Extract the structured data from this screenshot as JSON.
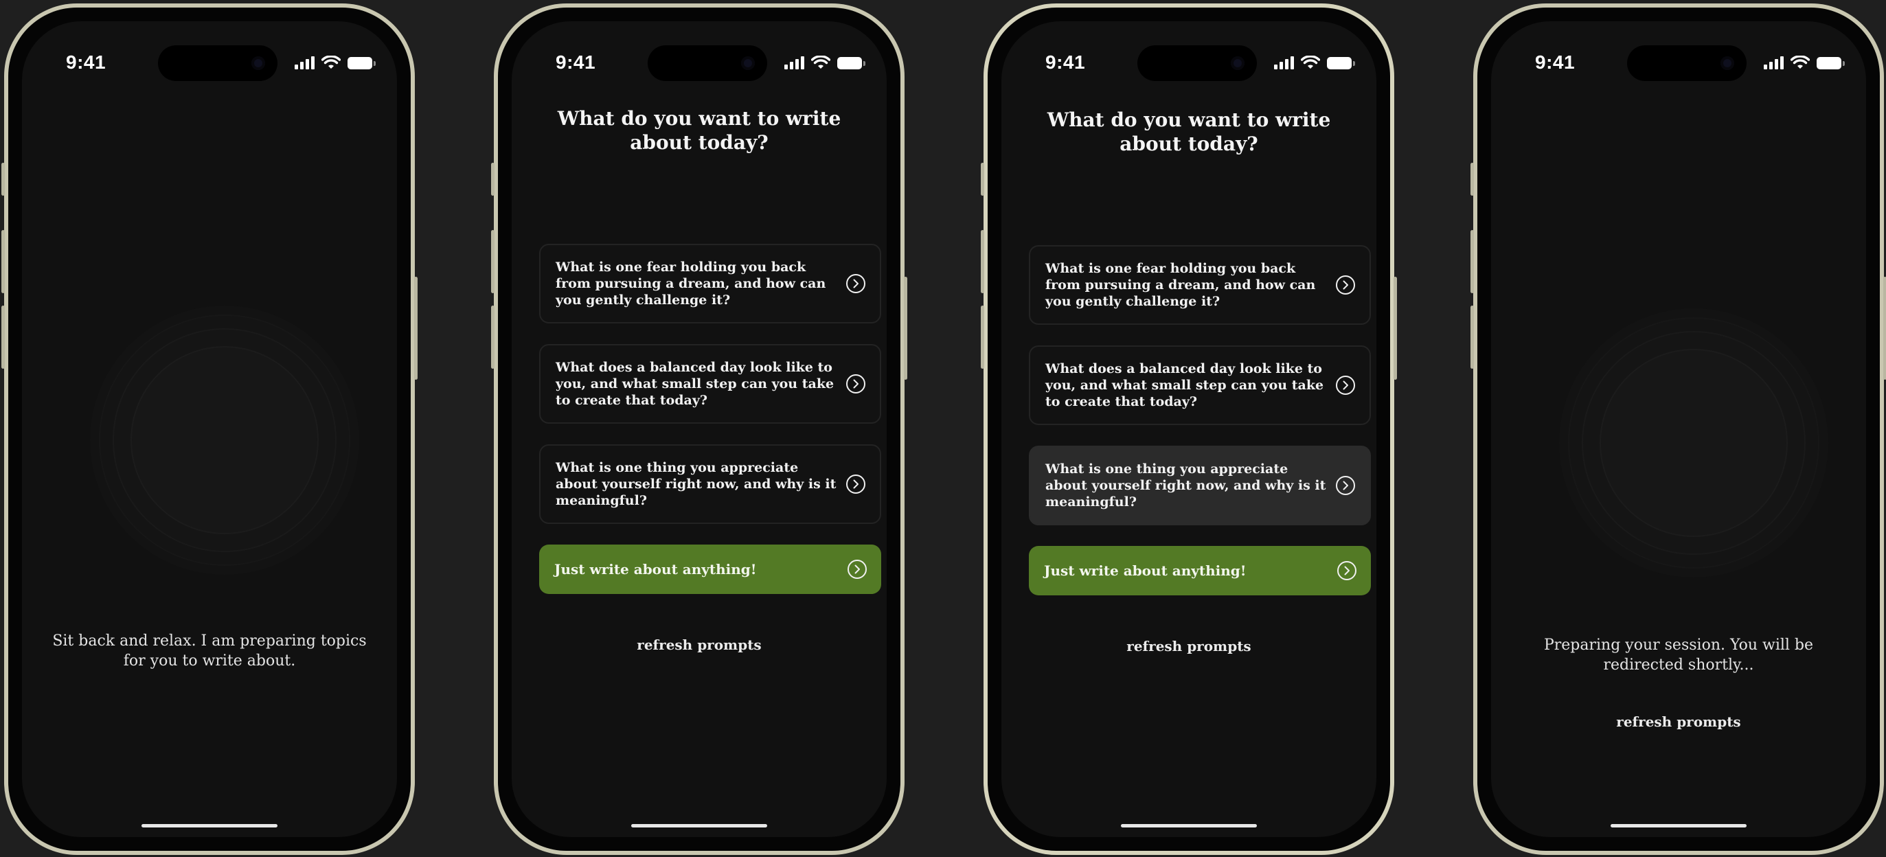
{
  "status_bar": {
    "time": "9:41"
  },
  "screens": [
    {
      "message": "Sit back and relax. I am preparing topics for you to write about."
    },
    {
      "title": "What do you want to write about today?",
      "prompts": [
        "What is one fear holding you back from pursuing a dream, and how can you gently challenge it?",
        "What does a balanced day look like to you, and what small step can you take to create that today?",
        "What is one thing you appreciate about yourself right now, and why is it meaningful?"
      ],
      "primary_label": "Just write about anything!",
      "refresh_label": "refresh prompts"
    },
    {
      "title": "What do you want to write about today?",
      "prompts": [
        "What is one fear holding you back from pursuing a dream, and how can you gently challenge it?",
        "What does a balanced day look like to you, and what small step can you take to create that today?",
        "What is one thing you appreciate about yourself right now, and why is it meaningful?"
      ],
      "highlighted_prompt_index": 2,
      "primary_label": "Just write about anything!",
      "refresh_label": "refresh prompts"
    },
    {
      "message": "Preparing your session. You will be redirected shortly...",
      "refresh_label": "refresh prompts"
    }
  ],
  "colors": {
    "background": "#1f1f1f",
    "phone_frame": "#c9c7b0",
    "screen": "#111111",
    "accent_green": "#537a25",
    "highlight_card": "#2b2b2b"
  },
  "icons": {
    "card_arrow": "chevron-right-circle-icon",
    "loader": "pulsing-circles-icon"
  }
}
